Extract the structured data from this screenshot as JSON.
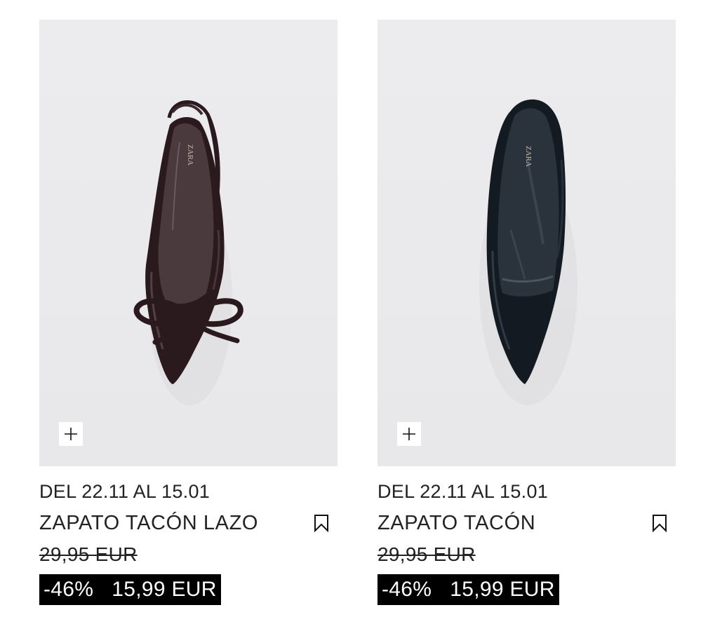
{
  "products": [
    {
      "image_alt": "black patent bow slingback kitten heel",
      "dates": "DEL 22.11 AL 15.01",
      "name": "ZAPATO TACÓN LAZO",
      "old_price": "29,95 EUR",
      "discount": "-46%",
      "price": "15,99 EUR",
      "brand_mark": "ZARA",
      "shoe_color": "#2a1a1e"
    },
    {
      "image_alt": "black pointed stiletto pump",
      "dates": "DEL 22.11 AL 15.01",
      "name": "ZAPATO TACÓN",
      "old_price": "29,95 EUR",
      "discount": "-46%",
      "price": "15,99 EUR",
      "brand_mark": "ZARA",
      "shoe_color": "#141a22"
    }
  ],
  "icons": {
    "add": "plus-icon",
    "save": "bookmark-icon"
  }
}
